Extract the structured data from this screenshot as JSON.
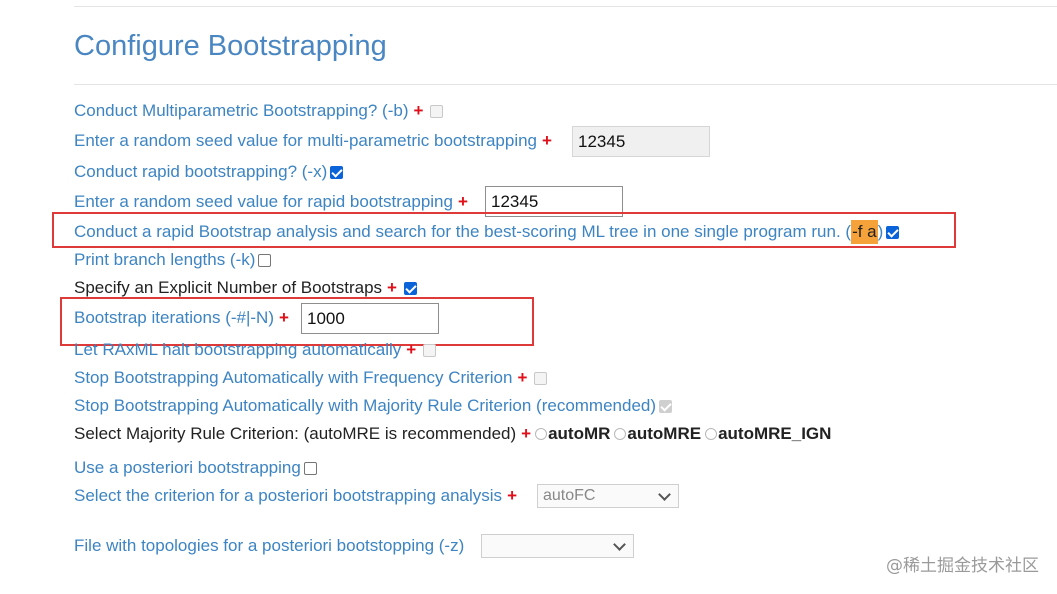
{
  "title": "Configure Bootstrapping",
  "required_mark": "+",
  "rows": {
    "mp_boot": "Conduct Multiparametric Bootstrapping? (-b)",
    "mp_seed": "Enter a random seed value for multi-parametric bootstrapping",
    "rapid": "Conduct rapid bootstrapping? (-x)",
    "rapid_seed": "Enter a random seed value for rapid bootstrapping",
    "rapid_ml": "Conduct a rapid Bootstrap analysis and search for the best-scoring ML tree in one single program run. (",
    "rapid_ml_flag": "-f a",
    "rapid_ml_close": ")",
    "branch": "Print branch lengths (-k)",
    "explicit": "Specify an Explicit Number of Bootstraps",
    "iterations": "Bootstrap iterations (-#|-N)",
    "halt": "Let RAxML halt bootstrapping automatically",
    "freq": "Stop Bootstrapping Automatically with Frequency Criterion",
    "majority": "Stop Bootstrapping Automatically with Majority Rule Criterion (recommended)",
    "select_mr": "Select Majority Rule Criterion: (autoMRE is recommended)",
    "posteriori": "Use a posteriori bootstrapping",
    "criterion": "Select the criterion for a posteriori bootstrapping analysis",
    "topologies": "File with topologies for a posteriori bootstopping (-z)"
  },
  "values": {
    "mp_seed": "12345",
    "rapid_seed": "12345",
    "iterations": "1000",
    "criterion": "autoFC",
    "topologies": ""
  },
  "radio_options": [
    "autoMR",
    "autoMRE",
    "autoMRE_IGN"
  ],
  "watermark": "@稀土掘金技术社区",
  "colors": {
    "accent": "#4a87c2",
    "required": "#e0101a",
    "highlight": "#f5a23a",
    "annotation": "#de3a3a"
  }
}
